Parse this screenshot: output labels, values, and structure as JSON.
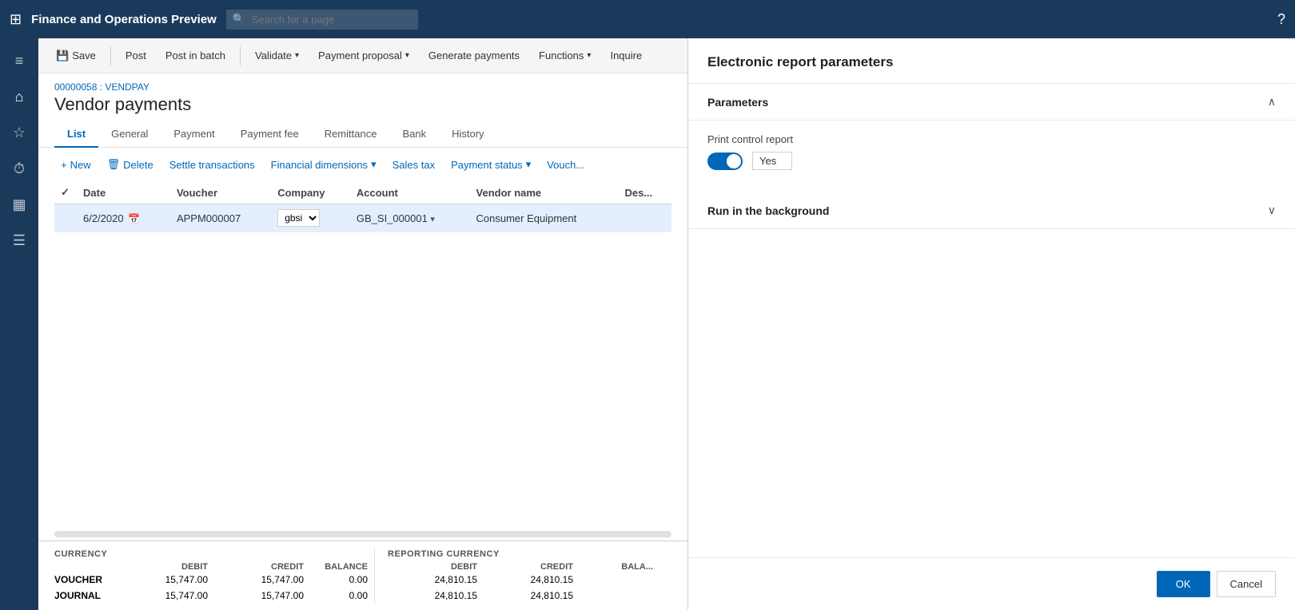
{
  "app": {
    "title": "Finance and Operations Preview",
    "search_placeholder": "Search for a page"
  },
  "toolbar": {
    "save_label": "Save",
    "post_label": "Post",
    "post_in_batch_label": "Post in batch",
    "validate_label": "Validate",
    "payment_proposal_label": "Payment proposal",
    "generate_payments_label": "Generate payments",
    "functions_label": "Functions",
    "inquire_label": "Inquire"
  },
  "page": {
    "breadcrumb": "00000058 : VENDPAY",
    "title": "Vendor payments"
  },
  "tabs": [
    {
      "id": "list",
      "label": "List",
      "active": true
    },
    {
      "id": "general",
      "label": "General",
      "active": false
    },
    {
      "id": "payment",
      "label": "Payment",
      "active": false
    },
    {
      "id": "payment_fee",
      "label": "Payment fee",
      "active": false
    },
    {
      "id": "remittance",
      "label": "Remittance",
      "active": false
    },
    {
      "id": "bank",
      "label": "Bank",
      "active": false
    },
    {
      "id": "history",
      "label": "History",
      "active": false
    }
  ],
  "sub_toolbar": {
    "new_label": "+ New",
    "delete_label": "Delete",
    "settle_transactions_label": "Settle transactions",
    "financial_dimensions_label": "Financial dimensions",
    "sales_tax_label": "Sales tax",
    "payment_status_label": "Payment status",
    "vouch_label": "Vouch..."
  },
  "table": {
    "columns": [
      "",
      "Date",
      "Voucher",
      "Company",
      "Account",
      "Vendor name",
      "Des..."
    ],
    "rows": [
      {
        "selected": true,
        "date": "6/2/2020",
        "voucher": "APPM000007",
        "company": "gbsi",
        "account": "GB_SI_000001",
        "vendor_name": "Consumer Equipment",
        "description": ""
      }
    ]
  },
  "footer": {
    "currency_label": "CURRENCY",
    "reporting_currency_label": "REPORTING CURRENCY",
    "debit_label": "DEBIT",
    "credit_label": "CREDIT",
    "balance_label": "BALANCE",
    "rows": [
      {
        "label": "VOUCHER",
        "debit": "15,747.00",
        "credit": "15,747.00",
        "balance": "0.00",
        "rep_debit": "24,810.15",
        "rep_credit": "24,810.15",
        "rep_balance": ""
      },
      {
        "label": "JOURNAL",
        "debit": "15,747.00",
        "credit": "15,747.00",
        "balance": "0.00",
        "rep_debit": "24,810.15",
        "rep_credit": "24,810.15",
        "rep_balance": ""
      }
    ]
  },
  "panel": {
    "title": "Electronic report parameters",
    "parameters_section": {
      "label": "Parameters",
      "print_control_report_label": "Print control report",
      "toggle_value": "Yes",
      "toggle_on": true
    },
    "run_in_background_section": {
      "label": "Run in the background",
      "expanded": false
    },
    "ok_label": "OK",
    "cancel_label": "Cancel"
  },
  "sidebar": {
    "icons": [
      {
        "name": "hamburger-icon",
        "symbol": "≡"
      },
      {
        "name": "home-icon",
        "symbol": "⌂"
      },
      {
        "name": "star-icon",
        "symbol": "☆"
      },
      {
        "name": "clock-icon",
        "symbol": "⏱"
      },
      {
        "name": "grid-icon",
        "symbol": "▦"
      },
      {
        "name": "list-icon",
        "symbol": "☰"
      }
    ]
  }
}
